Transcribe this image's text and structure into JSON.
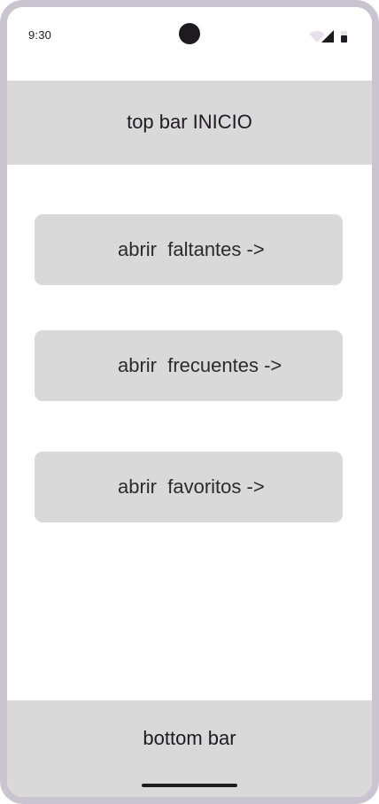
{
  "status_bar": {
    "time": "9:30",
    "icons": [
      "wifi-icon",
      "cellular-signal-icon",
      "battery-icon"
    ]
  },
  "top_bar": {
    "title": "top bar INICIO"
  },
  "menu": {
    "items": [
      {
        "label": "abrir  faltantes ->"
      },
      {
        "label": "abrir  frecuentes ->"
      },
      {
        "label": "abrir  favoritos ->"
      }
    ]
  },
  "bottom_bar": {
    "label": "bottom bar"
  },
  "colors": {
    "frame": "#cac4d0",
    "bar_background": "#d9d9d9",
    "button_background": "#d9d9d9",
    "text": "#1d1b20",
    "screen_background": "#ffffff"
  }
}
